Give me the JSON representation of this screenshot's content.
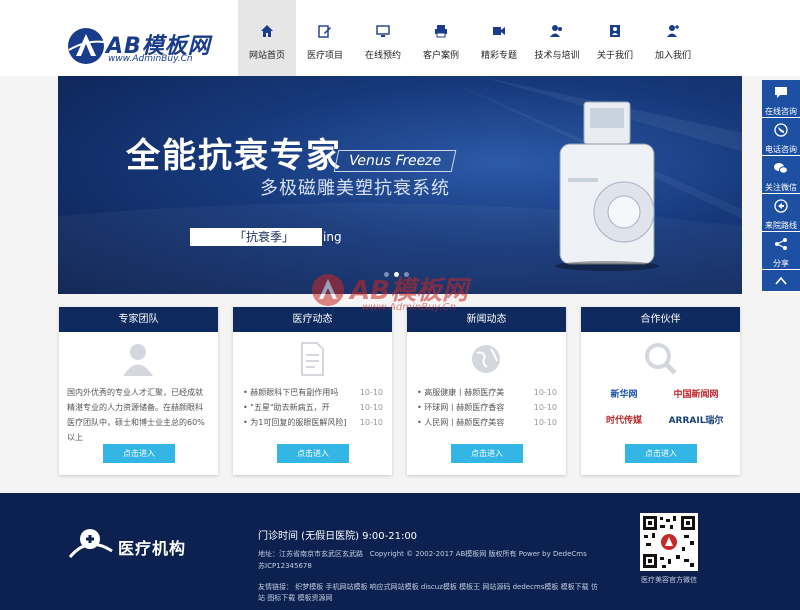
{
  "site": {
    "brand": "AB模板网",
    "brand_url": "www.AdminBuy.Cn",
    "colors": {
      "primary": "#0e2a5e",
      "accent": "#33b5e5",
      "side": "#1d4fa3"
    }
  },
  "nav": {
    "items": [
      {
        "label": "网站首页",
        "icon": "home-icon"
      },
      {
        "label": "医疗项目",
        "icon": "edit-icon"
      },
      {
        "label": "在线预约",
        "icon": "monitor-icon"
      },
      {
        "label": "客户案例",
        "icon": "printer-icon"
      },
      {
        "label": "精彩专题",
        "icon": "video-icon"
      },
      {
        "label": "技术与培训",
        "icon": "users-icon"
      },
      {
        "label": "关于我们",
        "icon": "contact-icon"
      },
      {
        "label": "加入我们",
        "icon": "user-add-icon"
      }
    ]
  },
  "banner": {
    "headline": "全能抗衰专家",
    "product_en": "Venus Freeze",
    "subtitle": "多极磁雕美塑抗衰系统",
    "tag_main": "「抗衰季」",
    "tag_suffix": "ing"
  },
  "side": {
    "items": [
      {
        "label": "在线咨询",
        "icon": "chat-icon"
      },
      {
        "label": "电话咨询",
        "icon": "phone-icon"
      },
      {
        "label": "关注微信",
        "icon": "wechat-icon"
      },
      {
        "label": "来院路线",
        "icon": "route-icon"
      },
      {
        "label": "分享",
        "icon": "share-icon"
      }
    ],
    "top_icon": "arrow-up-icon"
  },
  "cards": {
    "experts": {
      "title": "专家团队",
      "text": "国内外优秀的专业人才汇聚，已经成就精湛专业的人力资源储备。在赫颜眼科医疗团队中，硕士和博士业主总的60%以上",
      "button": "点击进入"
    },
    "medical": {
      "title": "医疗动态",
      "items": [
        {
          "text": "• 赫颜眼科下巴有副作用吗",
          "date": "10-10"
        },
        {
          "text": "• \"五星\"助去新病五，开",
          "date": "10-10"
        },
        {
          "text": "• 为1可回复的服眼医解风险]",
          "date": "10-10"
        }
      ],
      "button": "点击进入"
    },
    "news": {
      "title": "新闻动态",
      "items": [
        {
          "text": "• 高服健康丨赫颜医疗美",
          "date": "10-10"
        },
        {
          "text": "• 环球网丨赫颜医疗香容",
          "date": "10-10"
        },
        {
          "text": "• 人民网丨赫颜医疗美容",
          "date": "10-10"
        }
      ],
      "button": "点击进入"
    },
    "partners": {
      "title": "合作伙伴",
      "logos": [
        "新华网",
        "中国新闻网",
        "时代传媒",
        "ARRAIL瑞尔"
      ],
      "button": "点击进入"
    }
  },
  "footer": {
    "brand": "医疗机构",
    "hours": "门诊时间 (无假日医院) 9:00-21:00",
    "address": "地址：江苏省南京市玄武区玄武路",
    "copyright": "Copyright © 2002-2017 AB模板网 版权所有 Power by DedeCms",
    "icp": "苏ICP12345678",
    "links": "友情链接： 织梦模板 手机网站模板 响应式网站模板 discuz模板 模板王 网站源码 dedecms模板 模板下载 仿站 图标下载 模板资源网",
    "qr_caption": "医疗美容官方微信"
  },
  "watermark": {
    "brand": "AB模板网",
    "url": "www.AdminBuy.Cn"
  }
}
